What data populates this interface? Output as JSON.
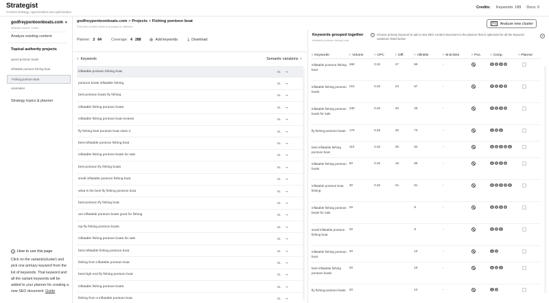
{
  "header": {
    "title": "Strategist",
    "subtitle": "Content strategy, opportunities and optimization",
    "credits_label": "Credits:",
    "keywords_label": "Keywords: 189",
    "docs_label": "Docs: 0"
  },
  "sidebar": {
    "domain": "godfreypontoonboats.com",
    "domain_sub": "Website launch: 10084",
    "analyze": "Analyze existing content",
    "topical": "Topical authority projects",
    "projects": [
      "speed pontoon boats",
      "inflatable pontoon fishing boat",
      "Fishing pontoon boat",
      "caramaker"
    ],
    "active_project": "Fishing pontoon boat",
    "strategy": "Strategy topics & planner",
    "howto_title": "How to use this page",
    "howto_body": "Click on the variants(cluster) and pick one primary keyword from the list of keywords. That keyword and all the variant keywords will be added to your planner for creating a new SEO document.",
    "howto_link": "Guide"
  },
  "main": {
    "crumb_domain": "godfreypontoonboats.com",
    "crumb_sep1": ">",
    "crumb_projects": "Projects",
    "crumb_sep2": ">",
    "crumb_current": "Fishing pontoon boat",
    "crumb_sub": "Find new content ideas and pages to optimize",
    "planner_label": "Planner:",
    "planner_a": "2",
    "planner_b": "64",
    "coverage_label": "Coverage:",
    "coverage_a": "4",
    "coverage_b": "288",
    "add_keywords": "Add keywords",
    "download": "Download",
    "col_keywords": "Keywords",
    "col_variations": "Semantic variations",
    "keywords": [
      {
        "kw": "inflatable pontoon fishing boat",
        "cnt": "61"
      },
      {
        "kw": "pontoon boats inflatable fishing",
        "cnt": "61"
      },
      {
        "kw": "best pontoon boats fly fishing",
        "cnt": "61"
      },
      {
        "kw": "inflatable fishing pontoon boats",
        "cnt": "61"
      },
      {
        "kw": "inflatable fishing pontoon boat reviews",
        "cnt": "61"
      },
      {
        "kw": "fly fishing best pontoon boat class 3",
        "cnt": "61"
      },
      {
        "kw": "best inflatable pontoon fishing boat",
        "cnt": "61"
      },
      {
        "kw": "inflatable fishing pontoon boats for sale",
        "cnt": "61"
      },
      {
        "kw": "best pontoon fly fishing boats",
        "cnt": "61"
      },
      {
        "kw": "small inflatable pontoon fishing boat",
        "cnt": "61"
      },
      {
        "kw": "what is the best fly fishing pontoon boat",
        "cnt": "61"
      },
      {
        "kw": "best pontoon fly fishing boat",
        "cnt": "61"
      },
      {
        "kw": "are inflatable pontoon boats good for fishing",
        "cnt": "61"
      },
      {
        "kw": "top fly fishing pontoon boats",
        "cnt": "61"
      },
      {
        "kw": "inflatable fishing pontoon boats for sale",
        "cnt": "61"
      },
      {
        "kw": "best inflatable fishing pontoon boat",
        "cnt": "61"
      },
      {
        "kw": "fishing from inflatable pontoon boat",
        "cnt": "61"
      },
      {
        "kw": "best high end fly fishing pontoon boat",
        "cnt": "61"
      },
      {
        "kw": "inflatable fishing pontoon boats",
        "cnt": "61"
      },
      {
        "kw": "fishing from a inflatable pontoon boat",
        "cnt": "61"
      }
    ]
  },
  "right": {
    "analyze_btn": "Analyze new cluster",
    "analyze_icon": "[+]",
    "title": "Keywords grouped together",
    "subtitle": "inflatable pontoon fishing boat",
    "note": "Choose primary keyword to add a new SEO content document to the planner that is optimized for all the keyword variations listed below",
    "columns": [
      "Keywords",
      "Volume",
      "CPC",
      "Diff.",
      "Allintitle",
      "M.B.links",
      "Pos.",
      "Comp.",
      "Planner"
    ],
    "rows": [
      {
        "kw": "inflatable pontoon fishing boat",
        "vol": "260",
        "cpc": "0.32",
        "diff": "27",
        "allin": "59",
        "mb": "-",
        "comp": [
          "5",
          "4",
          "6",
          "8"
        ]
      },
      {
        "kw": "inflatable fishing pontoon boats",
        "vol": "210",
        "cpc": "0.32",
        "diff": "23",
        "allin": "57",
        "mb": "-",
        "comp": [
          "5",
          "4",
          "5",
          "8"
        ]
      },
      {
        "kw": "inflatable fishing pontoon boats for sale",
        "vol": "230",
        "cpc": "0.32",
        "diff": "20",
        "allin": "29",
        "mb": "-",
        "comp": [
          "5",
          "4",
          "5",
          "6"
        ]
      },
      {
        "kw": "fly fishing pontoon boats",
        "vol": "170",
        "cpc": "0.46",
        "diff": "30",
        "allin": "73",
        "mb": "-",
        "comp": [
          "4",
          "5",
          "6"
        ]
      },
      {
        "kw": "best inflatable fishing pontoon boat",
        "vol": "110",
        "cpc": "0.32",
        "diff": "25",
        "allin": "62",
        "mb": "-",
        "comp": [
          "5",
          "4",
          "5",
          "6",
          "8"
        ]
      },
      {
        "kw": "inflatable fishing pontoon boats",
        "vol": "50",
        "cpc": "0.32",
        "diff": "19",
        "allin": "56",
        "mb": "-",
        "comp": [
          "5",
          "4",
          "5",
          "6"
        ]
      },
      {
        "kw": "inflatable pontoon boat fishing",
        "vol": "30",
        "cpc": "0.32",
        "diff": "21",
        "allin": "61",
        "mb": "-",
        "comp": [
          "5",
          "4",
          "5",
          "6",
          "8"
        ]
      },
      {
        "kw": "inflatable fishing pontoon boats for sale",
        "vol": "20",
        "cpc": "",
        "diff": "",
        "allin": "9",
        "mb": "-",
        "comp": [
          "5",
          "4",
          "6",
          "8"
        ]
      },
      {
        "kw": "small inflatable pontoon fishing boat",
        "vol": "20",
        "cpc": "",
        "diff": "",
        "allin": "8",
        "mb": "-",
        "comp": [
          "5",
          "6",
          "8"
        ]
      },
      {
        "kw": "inflatable fishing pontoon boat",
        "vol": "20",
        "cpc": "",
        "diff": "",
        "allin": "10",
        "mb": "-",
        "comp": [
          "4",
          "6"
        ]
      },
      {
        "kw": "best inflatable fishing pontoon boats",
        "vol": "20",
        "cpc": "",
        "diff": "",
        "allin": "16",
        "mb": "-",
        "comp": [
          "5",
          "6",
          "8"
        ]
      },
      {
        "kw": "fly fishing pontoon boats",
        "vol": "20",
        "cpc": "",
        "diff": "",
        "allin": "12",
        "mb": "-",
        "comp": [
          "4",
          "6"
        ]
      }
    ]
  }
}
